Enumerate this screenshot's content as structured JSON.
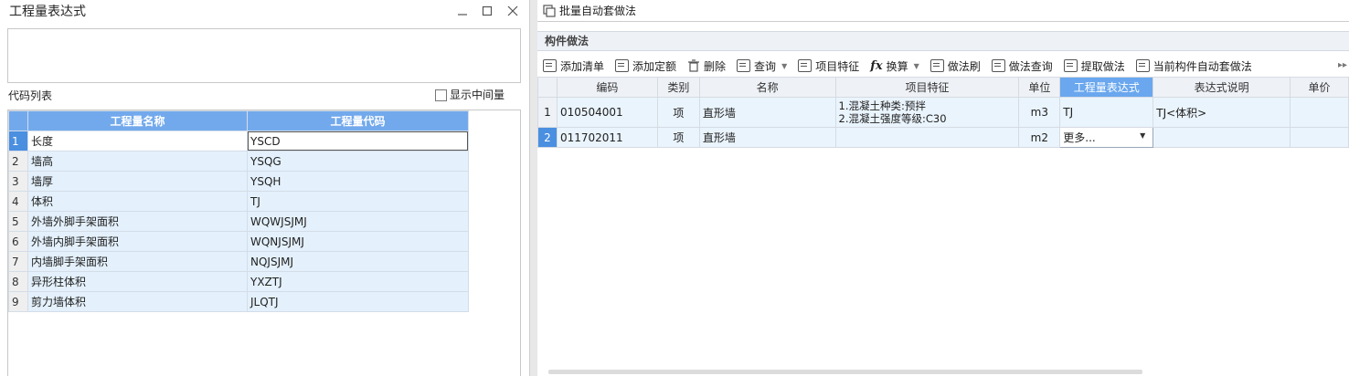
{
  "dialog": {
    "title": "工程量表达式",
    "code_list_label": "代码列表",
    "show_intermediate_label": "显示中间量",
    "table": {
      "headers": [
        "工程量名称",
        "工程量代码"
      ],
      "rows": [
        {
          "no": "1",
          "name": "长度",
          "code": "YSCD"
        },
        {
          "no": "2",
          "name": "墙高",
          "code": "YSQG"
        },
        {
          "no": "3",
          "name": "墙厚",
          "code": "YSQH"
        },
        {
          "no": "4",
          "name": "体积",
          "code": "TJ"
        },
        {
          "no": "5",
          "name": "外墙外脚手架面积",
          "code": "WQWJSJMJ"
        },
        {
          "no": "6",
          "name": "外墙内脚手架面积",
          "code": "WQNJSJMJ"
        },
        {
          "no": "7",
          "name": "内墙脚手架面积",
          "code": "NQJSJMJ"
        },
        {
          "no": "8",
          "name": "异形柱体积",
          "code": "YXZTJ"
        },
        {
          "no": "9",
          "name": "剪力墙体积",
          "code": "JLQTJ"
        }
      ]
    }
  },
  "topbar": {
    "batch_label": "批量自动套做法"
  },
  "section": {
    "title": "构件做法"
  },
  "toolbar": {
    "add_list": "添加清单",
    "add_quota": "添加定额",
    "delete": "删除",
    "query": "查询",
    "item_feature": "项目特征",
    "convert_icon_text": "fx",
    "convert": "换算",
    "method_brush": "做法刷",
    "method_query": "做法查询",
    "extract_method": "提取做法",
    "auto_method": "当前构件自动套做法",
    "more": "▸▸"
  },
  "grid": {
    "headers": [
      "编码",
      "类别",
      "名称",
      "项目特征",
      "单位",
      "工程量表达式",
      "表达式说明",
      "单价"
    ],
    "rows": [
      {
        "no": "1",
        "code": "010504001",
        "type": "项",
        "name": "直形墙",
        "feature_1": "1.混凝土种类:预拌",
        "feature_2": "2.混凝土强度等级:C30",
        "unit": "m3",
        "expr": "TJ",
        "desc": "TJ<体积>",
        "price": ""
      },
      {
        "no": "2",
        "code": "011702011",
        "type": "项",
        "name": "直形墙",
        "unit": "m2",
        "expr": "更多...",
        "desc": "",
        "price": ""
      }
    ]
  }
}
